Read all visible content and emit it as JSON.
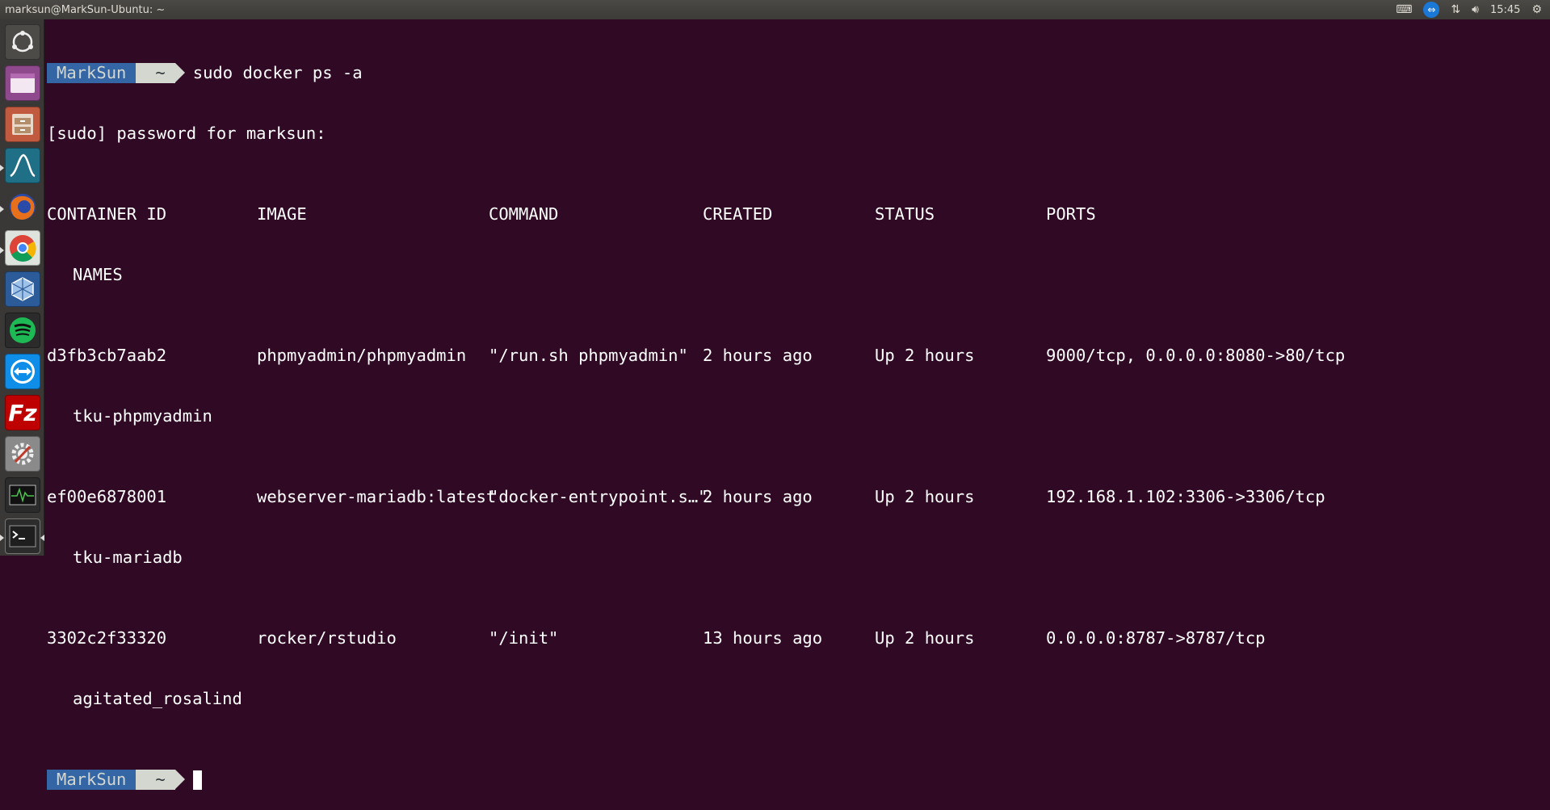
{
  "topbar": {
    "title": "marksun@MarkSun-Ubuntu: ~",
    "clock": "15:45",
    "indicators": [
      "keyboard-icon",
      "teamviewer-icon",
      "network-icon",
      "volume-icon",
      "power-gear-icon"
    ]
  },
  "launcher": {
    "items": [
      {
        "name": "dash-home-icon",
        "color": "#5a5855"
      },
      {
        "name": "files-purple-icon",
        "color": "#8e4a8c"
      },
      {
        "name": "file-cabinet-icon",
        "color": "#c25a3f"
      },
      {
        "name": "matlab-icon",
        "color": "#1f6f86"
      },
      {
        "name": "firefox-icon",
        "color": "#e8701a"
      },
      {
        "name": "chrome-icon",
        "color": "#dfe3dd"
      },
      {
        "name": "virtualbox-icon",
        "color": "#2c5b9a"
      },
      {
        "name": "spotify-icon",
        "color": "#1db954"
      },
      {
        "name": "teamviewer-icon",
        "color": "#0e8ee9"
      },
      {
        "name": "filezilla-icon",
        "color": "#bf0000"
      },
      {
        "name": "settings-icon",
        "color": "#8a8a8a"
      },
      {
        "name": "system-monitor-icon",
        "color": "#2b2b2b"
      },
      {
        "name": "terminal-icon",
        "color": "#2c2c2c"
      }
    ]
  },
  "terminal": {
    "prompt_user": "MarkSun",
    "prompt_dir": "~",
    "command": "sudo docker ps -a",
    "sudo_line": "[sudo] password for marksun:",
    "headers": {
      "container_id": "CONTAINER ID",
      "image": "IMAGE",
      "command": "COMMAND",
      "created": "CREATED",
      "status": "STATUS",
      "ports": "PORTS",
      "names": "NAMES"
    },
    "rows": [
      {
        "container_id": "d3fb3cb7aab2",
        "image": "phpmyadmin/phpmyadmin",
        "command": "\"/run.sh phpmyadmin\"",
        "created": "2 hours ago",
        "status": "Up 2 hours",
        "ports": "9000/tcp, 0.0.0.0:8080->80/tcp",
        "names": "tku-phpmyadmin"
      },
      {
        "container_id": "ef00e6878001",
        "image": "webserver-mariadb:latest",
        "command": "\"docker-entrypoint.s…\"",
        "created": "2 hours ago",
        "status": "Up 2 hours",
        "ports": "192.168.1.102:3306->3306/tcp",
        "names": "tku-mariadb"
      },
      {
        "container_id": "3302c2f33320",
        "image": "rocker/rstudio",
        "command": "\"/init\"",
        "created": "13 hours ago",
        "status": "Up 2 hours",
        "ports": "0.0.0.0:8787->8787/tcp",
        "names": "agitated_rosalind"
      }
    ]
  }
}
